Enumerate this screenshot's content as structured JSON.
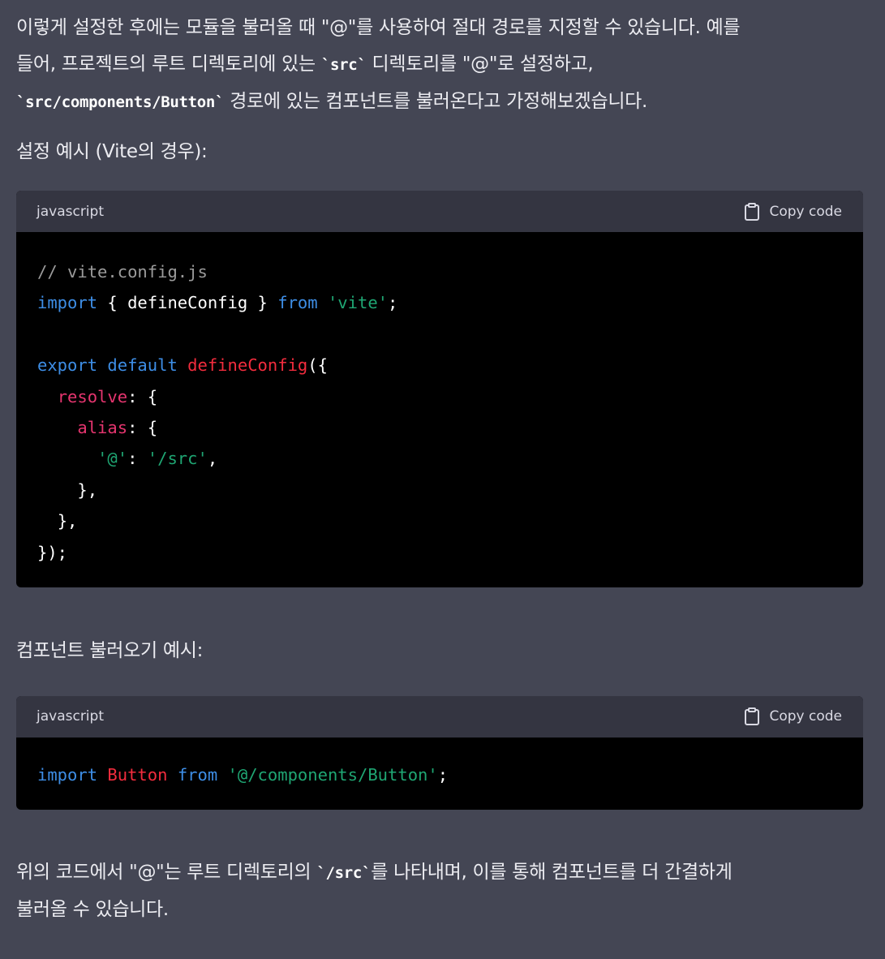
{
  "intro": {
    "line1": "이렇게 설정한 후에는 모듈을 불러올 때 \"@\"를 사용하여 절대 경로를 지정할 수 있습니다. 예를",
    "line2_a": "들어, 프로젝트의 루트 디렉토리에 있는 ",
    "line2_code": "`src`",
    "line2_b": " 디렉토리를 \"@\"로 설정하고,",
    "line3_code": "`src/components/Button`",
    "line3_b": " 경로에 있는 컴포넌트를 불러온다고 가정해보겠습니다."
  },
  "section1_heading": "설정 예시 (Vite의 경우):",
  "code1": {
    "language": "javascript",
    "copy_label": "Copy code",
    "comment": "// vite.config.js",
    "l2_import": "import",
    "l2_brace_open": " { defineConfig } ",
    "l2_from": "from",
    "l2_str": "'vite'",
    "l2_semi": ";",
    "l4_export": "export",
    "l4_default": "default",
    "l4_fn": "defineConfig",
    "l4_paren": "({",
    "l5_prop": "resolve",
    "l5_rest": ": {",
    "l6_prop": "alias",
    "l6_rest": ": {",
    "l7_key": "'@'",
    "l7_colon": ": ",
    "l7_val": "'/src'",
    "l7_comma": ",",
    "l8": "},",
    "l9": "},",
    "l10": "});"
  },
  "section2_heading": "컴포넌트 불러오기 예시:",
  "code2": {
    "language": "javascript",
    "copy_label": "Copy code",
    "import": "import",
    "name": "Button",
    "from": "from",
    "str": "'@/components/Button'",
    "semi": ";"
  },
  "outro": {
    "line1_a": "위의 코드에서 \"@\"는 루트 디렉토리의 ",
    "line1_code": "`/src`",
    "line1_b": "를 나타내며, 이를 통해 컴포넌트를 더 간결하게",
    "line2": "불러올 수 있습니다."
  },
  "colors": {
    "background": "#444654",
    "code_header": "#343541",
    "code_body": "#000000",
    "keyword": "#3e8ee6",
    "string": "#1fa673",
    "function": "#f22c3d",
    "property": "#e6356f",
    "comment": "#9b9b9b"
  },
  "icons": {
    "copy": "clipboard-icon"
  }
}
